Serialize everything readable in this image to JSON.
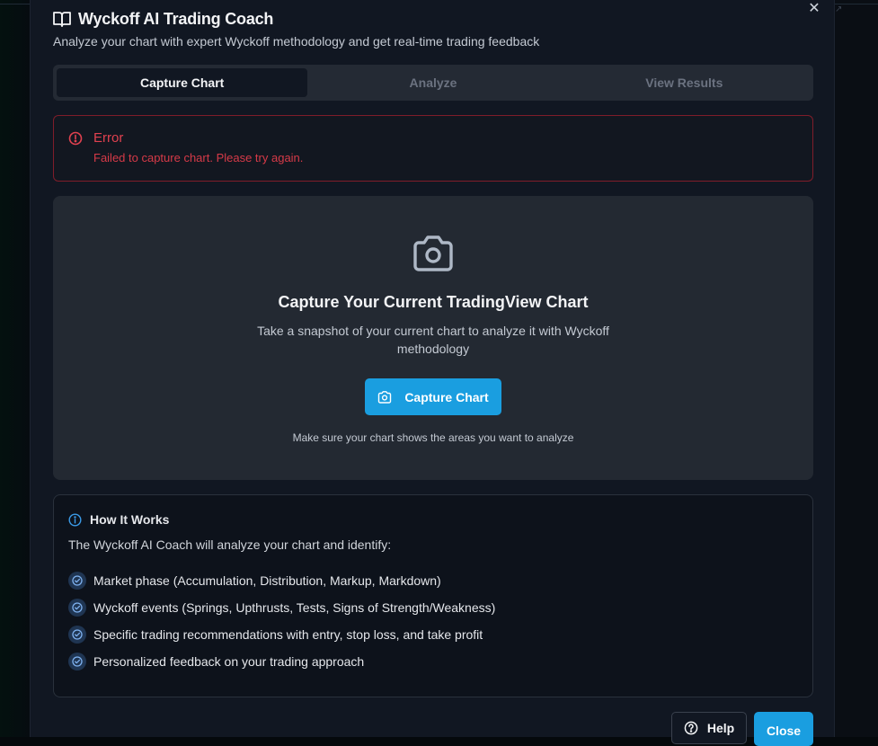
{
  "header": {
    "title": "Wyckoff AI Trading Coach",
    "subtitle": "Analyze your chart with expert Wyckoff methodology and get real-time trading feedback",
    "icon": "book-icon",
    "close_icon": "close-icon"
  },
  "tabs": [
    {
      "label": "Capture Chart",
      "active": true
    },
    {
      "label": "Analyze",
      "active": false
    },
    {
      "label": "View Results",
      "active": false
    }
  ],
  "error": {
    "title": "Error",
    "message": "Failed to capture chart. Please try again.",
    "icon": "alert-circle-icon"
  },
  "capture": {
    "heading": "Capture Your Current TradingView Chart",
    "description": "Take a snapshot of your current chart to analyze it with Wyckoff methodology",
    "button_label": "Capture Chart",
    "hint": "Make sure your chart shows the areas you want to analyze",
    "icon": "camera-icon"
  },
  "how_it_works": {
    "title": "How It Works",
    "intro": "The Wyckoff AI Coach will analyze your chart and identify:",
    "items": [
      "Market phase (Accumulation, Distribution, Markup, Markdown)",
      "Wyckoff events (Springs, Upthrusts, Tests, Signs of Strength/Weakness)",
      "Specific trading recommendations with entry, stop loss, and take profit",
      "Personalized feedback on your trading approach"
    ],
    "icon": "info-icon"
  },
  "footer": {
    "help_label": "Help",
    "close_label": "Close"
  },
  "colors": {
    "accent": "#1a9ee0",
    "error": "#e0414f",
    "background": "#111722"
  }
}
